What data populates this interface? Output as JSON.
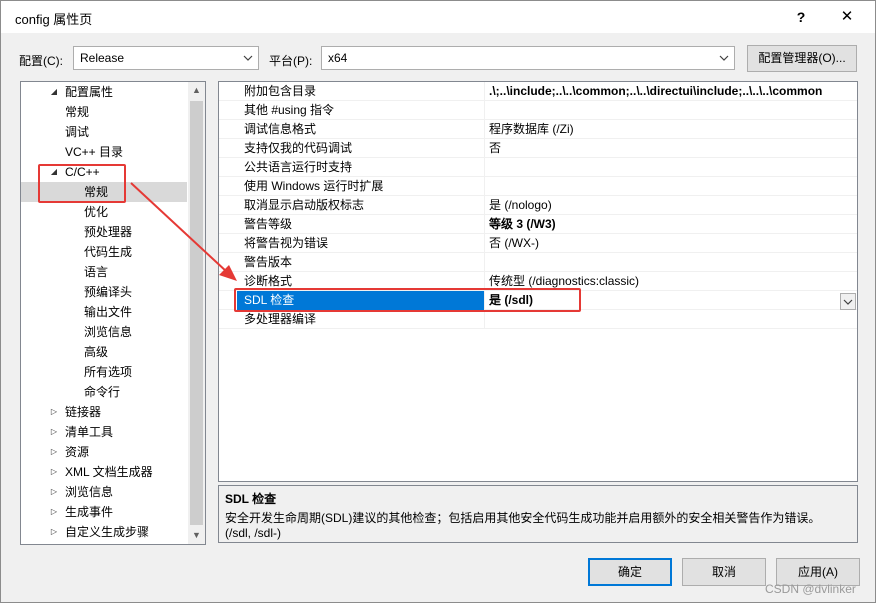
{
  "window": {
    "title": "config 属性页",
    "help_glyph": "?",
    "close_glyph": "✕"
  },
  "config_row": {
    "config_label": "配置(C):",
    "config_value": "Release",
    "platform_label": "平台(P):",
    "platform_value": "x64",
    "config_manager_label": "配置管理器(O)..."
  },
  "tree": {
    "items": [
      {
        "label": "配置属性",
        "expander": "expanded"
      },
      {
        "label": "常规"
      },
      {
        "label": "调试"
      },
      {
        "label": "VC++ 目录"
      },
      {
        "label": "C/C++",
        "expander": "expanded"
      },
      {
        "label": "常规",
        "selected": true
      },
      {
        "label": "优化"
      },
      {
        "label": "预处理器"
      },
      {
        "label": "代码生成"
      },
      {
        "label": "语言"
      },
      {
        "label": "预编译头"
      },
      {
        "label": "输出文件"
      },
      {
        "label": "浏览信息"
      },
      {
        "label": "高级"
      },
      {
        "label": "所有选项"
      },
      {
        "label": "命令行"
      },
      {
        "label": "链接器",
        "expander": "collapsed"
      },
      {
        "label": "清单工具",
        "expander": "collapsed"
      },
      {
        "label": "资源",
        "expander": "collapsed"
      },
      {
        "label": "XML 文档生成器",
        "expander": "collapsed"
      },
      {
        "label": "浏览信息",
        "expander": "collapsed"
      },
      {
        "label": "生成事件",
        "expander": "collapsed"
      },
      {
        "label": "自定义生成步骤",
        "expander": "collapsed"
      }
    ]
  },
  "properties": [
    {
      "name": "附加包含目录",
      "value": ".\\;..\\include;..\\..\\common;..\\..\\directui\\include;..\\..\\..\\common",
      "bold": true
    },
    {
      "name": "其他 #using 指令",
      "value": ""
    },
    {
      "name": "调试信息格式",
      "value": "程序数据库 (/Zi)"
    },
    {
      "name": "支持仅我的代码调试",
      "value": "否"
    },
    {
      "name": "公共语言运行时支持",
      "value": ""
    },
    {
      "name": "使用 Windows 运行时扩展",
      "value": ""
    },
    {
      "name": "取消显示启动版权标志",
      "value": "是 (/nologo)"
    },
    {
      "name": "警告等级",
      "value": "等级 3 (/W3)",
      "bold": true
    },
    {
      "name": "将警告视为错误",
      "value": "否 (/WX-)"
    },
    {
      "name": "警告版本",
      "value": ""
    },
    {
      "name": "诊断格式",
      "value": "传统型 (/diagnostics:classic)"
    },
    {
      "name": "SDL 检查",
      "value": "是 (/sdl)",
      "selected": true
    },
    {
      "name": "多处理器编译",
      "value": ""
    }
  ],
  "description": {
    "title": "SDL 检查",
    "text": "安全开发生命周期(SDL)建议的其他检查；包括启用其他安全代码生成功能并启用额外的安全相关警告作为错误。",
    "switches": "(/sdl, /sdl-)"
  },
  "buttons": {
    "ok": "确定",
    "cancel": "取消",
    "apply": "应用(A)"
  },
  "watermark": "CSDN @dvlinker",
  "colors": {
    "accent": "#0078d7",
    "annotation": "#e53935",
    "selected_tree_bg": "#d9d9d9"
  }
}
